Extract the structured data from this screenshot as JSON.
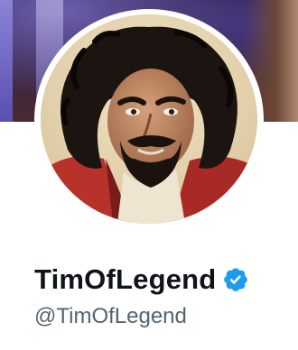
{
  "profile": {
    "display_name": "TimOfLegend",
    "handle": "@TimOfLegend",
    "verified": true
  },
  "icons": {
    "verified": "verified-badge-icon",
    "avatar": "avatar-illustration"
  },
  "colors": {
    "name_text": "#0f1419",
    "handle_text": "#536471",
    "verified_blue": "#1d9bf0",
    "background": "#ffffff"
  }
}
